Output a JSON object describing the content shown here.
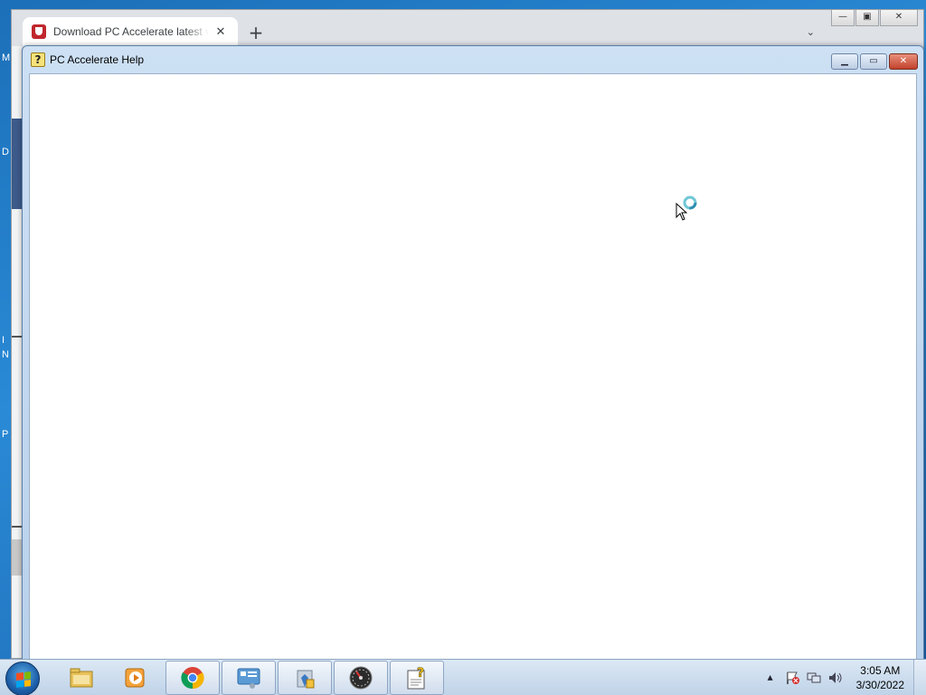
{
  "desktop": {
    "edge_labels": [
      "M",
      "D",
      "I",
      "N",
      "P"
    ]
  },
  "browser": {
    "tab": {
      "title": "Download PC Accelerate latest version",
      "close_icon": "close-icon"
    },
    "new_tab_icon": "plus-icon",
    "tab_search_icon": "chevron-down-icon",
    "window_controls": {
      "minimize": "minimize-icon",
      "maximize": "maximize-icon",
      "close": "close-icon"
    }
  },
  "help_window": {
    "title": "PC Accelerate Help",
    "icon": "help-book-icon",
    "controls": {
      "minimize": "minimize-icon",
      "maximize": "maximize-icon",
      "close": "close-icon"
    }
  },
  "taskbar": {
    "start": "windows-start-icon",
    "pinned": [
      {
        "name": "file-explorer-icon",
        "active": false
      },
      {
        "name": "media-player-icon",
        "active": false
      },
      {
        "name": "chrome-icon",
        "active": true
      },
      {
        "name": "control-panel-icon",
        "active": true
      },
      {
        "name": "installer-icon",
        "active": true
      },
      {
        "name": "speedometer-app-icon",
        "active": true
      },
      {
        "name": "help-icon",
        "active": true
      }
    ],
    "tray": {
      "icons": [
        "show-hidden-icons-arrow",
        "action-center-flag-icon",
        "network-icon",
        "volume-icon"
      ],
      "time": "3:05 AM",
      "date": "3/30/2022"
    }
  },
  "colors": {
    "desktop_blue": "#1c6fb8",
    "help_frame": "#b9d1ec",
    "close_red": "#c2422c",
    "taskbar": "#bfd3e8"
  }
}
